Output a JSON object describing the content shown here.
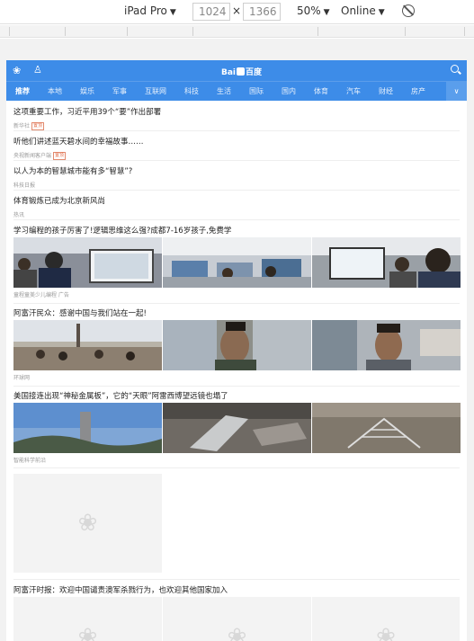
{
  "devtools": {
    "device": "iPad Pro",
    "width": "1024",
    "times": "×",
    "height": "1366",
    "zoom": "50%",
    "network": "Online",
    "caret": "▼"
  },
  "header": {
    "logo_text": "Bai",
    "logo_suffix": "百度"
  },
  "tabs": [
    "推荐",
    "本地",
    "娱乐",
    "军事",
    "互联网",
    "科技",
    "生活",
    "国际",
    "国内",
    "体育",
    "汽车",
    "财经",
    "房产"
  ],
  "tab_more": "∨",
  "news": [
    {
      "title": "这项重要工作，习近平用39个“要”作出部署",
      "source": "新华社",
      "tag": "置顶"
    },
    {
      "title": "听他们讲述蓝天碧水间的幸福故事……",
      "source": "央视新闻客户端",
      "tag": "置顶"
    },
    {
      "title": "以人为本的智慧城市能有多“智慧”?",
      "source": "科技日报",
      "tag": ""
    },
    {
      "title": "体育锻炼已成为北京新风尚",
      "source": "热讯",
      "tag": ""
    }
  ],
  "image_news": [
    {
      "title": "学习编程的孩子厉害了!逻辑思维这么强?成都7-16岁孩子,免费学",
      "source": "童程童美少儿编程 广告"
    },
    {
      "title": "阿富汗民众：感谢中国与我们站在一起!",
      "source": "环球网"
    },
    {
      "title": "美国接连出现“神秘金属板”，它的“天眼”阿雷西博望远镜也塌了",
      "source": "智能科学前沿"
    }
  ],
  "last_news": {
    "title": "阿富汗时报：欢迎中国谴责澳军杀戮行为，也欢迎其他国家加入"
  },
  "colors": {
    "brand": "#3d8ce8",
    "tag": "#e06a45"
  },
  "icons": {
    "paw": "paw-icon",
    "user": "user-icon",
    "search": "search-icon",
    "image": "image-placeholder-icon"
  }
}
